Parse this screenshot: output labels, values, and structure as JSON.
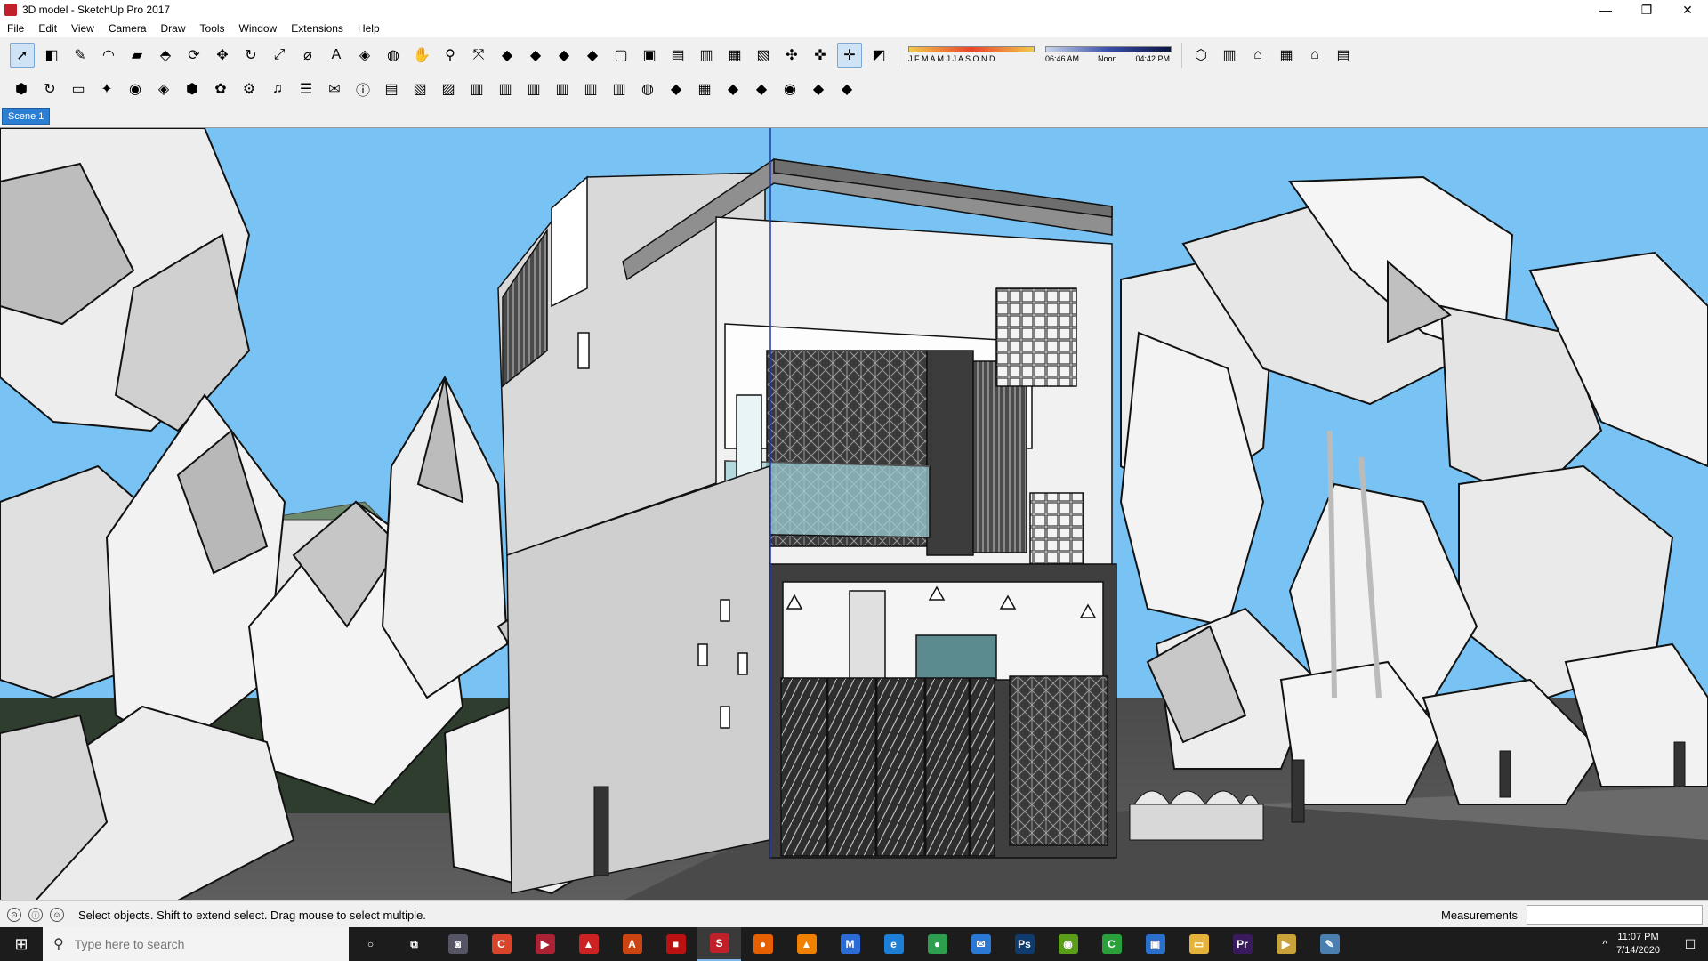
{
  "window": {
    "title": "3D model - SketchUp Pro 2017",
    "controls": [
      "—",
      "❐",
      "✕"
    ]
  },
  "menu": [
    "File",
    "Edit",
    "View",
    "Camera",
    "Draw",
    "Tools",
    "Window",
    "Extensions",
    "Help"
  ],
  "shadow_settings": {
    "months": "J F M A M J J A S O N D",
    "time_start": "06:46 AM",
    "time_noon": "Noon",
    "time_end": "04:42 PM"
  },
  "scenes": [
    "Scene 1"
  ],
  "status": {
    "hint": "Select objects. Shift to extend select. Drag mouse to select multiple.",
    "measurements_label": "Measurements",
    "measurements_value": ""
  },
  "taskbar": {
    "search_placeholder": "Type here to search",
    "time": "11:07 PM",
    "date": "7/14/2020",
    "apps": [
      {
        "name": "cortana-icon",
        "glyph": "○",
        "color": "#1c1c1c"
      },
      {
        "name": "task-view-icon",
        "glyph": "⧉",
        "color": "#1c1c1c"
      },
      {
        "name": "camera-icon",
        "glyph": "◙",
        "color": "#556"
      },
      {
        "name": "screen-recorder-icon",
        "glyph": "C",
        "color": "#d9452b"
      },
      {
        "name": "media-player-icon",
        "glyph": "▶",
        "color": "#a23"
      },
      {
        "name": "pdf-tool-icon",
        "glyph": "▲",
        "color": "#c22"
      },
      {
        "name": "autocad-icon",
        "glyph": "A",
        "color": "#c41"
      },
      {
        "name": "red-app-icon",
        "glyph": "■",
        "color": "#b11"
      },
      {
        "name": "sketchup-icon",
        "glyph": "S",
        "color": "#c0202a"
      },
      {
        "name": "firefox-icon",
        "glyph": "●",
        "color": "#e66000"
      },
      {
        "name": "vlc-icon",
        "glyph": "▲",
        "color": "#f08000"
      },
      {
        "name": "maya-icon",
        "glyph": "M",
        "color": "#2a6bd6"
      },
      {
        "name": "edge-icon",
        "glyph": "e",
        "color": "#1e7fd6"
      },
      {
        "name": "chrome-icon",
        "glyph": "●",
        "color": "#2e9e4f"
      },
      {
        "name": "mail-icon",
        "glyph": "✉",
        "color": "#2a79d4"
      },
      {
        "name": "photoshop-icon",
        "glyph": "Ps",
        "color": "#0f3b6e"
      },
      {
        "name": "nvidia-icon",
        "glyph": "◉",
        "color": "#5a9e1a"
      },
      {
        "name": "camtasia-icon",
        "glyph": "C",
        "color": "#29a03a"
      },
      {
        "name": "store-icon",
        "glyph": "▣",
        "color": "#2a6fc9"
      },
      {
        "name": "file-explorer-icon",
        "glyph": "▭",
        "color": "#e6b33a"
      },
      {
        "name": "premiere-icon",
        "glyph": "Pr",
        "color": "#3a1a5e"
      },
      {
        "name": "media-icon",
        "glyph": "▶",
        "color": "#c9a23a"
      },
      {
        "name": "paint-icon",
        "glyph": "✎",
        "color": "#4a7fb0"
      }
    ],
    "tray_glyph": "^",
    "notification_glyph": "☐"
  },
  "toolbar1": [
    {
      "name": "select-tool-icon",
      "glyph": "➚",
      "active": true
    },
    {
      "name": "eraser-tool-icon",
      "glyph": "◧"
    },
    {
      "name": "line-tool-icon",
      "glyph": "✎"
    },
    {
      "name": "arc-tool-icon",
      "glyph": "◠"
    },
    {
      "name": "rectangle-tool-icon",
      "glyph": "▰"
    },
    {
      "name": "push-pull-tool-icon",
      "glyph": "⬘"
    },
    {
      "name": "offset-tool-icon",
      "glyph": "⟳"
    },
    {
      "name": "move-tool-icon",
      "glyph": "✥"
    },
    {
      "name": "rotate-tool-icon",
      "glyph": "↻"
    },
    {
      "name": "scale-tool-icon",
      "glyph": "⤢"
    },
    {
      "name": "tape-measure-tool-icon",
      "glyph": "⌀"
    },
    {
      "name": "text-tool-icon",
      "glyph": "A"
    },
    {
      "name": "paint-bucket-tool-icon",
      "glyph": "◈"
    },
    {
      "name": "orbit-tool-icon",
      "glyph": "◍"
    },
    {
      "name": "pan-tool-icon",
      "glyph": "✋"
    },
    {
      "name": "zoom-tool-icon",
      "glyph": "⚲"
    },
    {
      "name": "zoom-extents-tool-icon",
      "glyph": "⤧"
    },
    {
      "name": "3d-warehouse-icon",
      "glyph": "◆"
    },
    {
      "name": "extension-warehouse-icon",
      "glyph": "◆"
    },
    {
      "name": "layout-icon",
      "glyph": "◆"
    },
    {
      "name": "ruby-console-icon",
      "glyph": "◆"
    },
    {
      "name": "xray-style-icon",
      "glyph": "▢"
    },
    {
      "name": "back-edges-style-icon",
      "glyph": "▣"
    },
    {
      "name": "wireframe-style-icon",
      "glyph": "▤"
    },
    {
      "name": "hidden-line-style-icon",
      "glyph": "▥"
    },
    {
      "name": "shaded-style-icon",
      "glyph": "▦"
    },
    {
      "name": "textured-style-icon",
      "glyph": "▧"
    },
    {
      "name": "section-plane-icon",
      "glyph": "✣"
    },
    {
      "name": "display-section-planes-icon",
      "glyph": "✜"
    },
    {
      "name": "display-section-cuts-icon",
      "glyph": "✛",
      "active": true
    },
    {
      "name": "shadows-toggle-icon",
      "glyph": "◩"
    }
  ],
  "toolbar1_right": [
    {
      "name": "iso-view-icon",
      "glyph": "⬡"
    },
    {
      "name": "top-view-icon",
      "glyph": "▥"
    },
    {
      "name": "front-view-icon",
      "glyph": "⌂"
    },
    {
      "name": "right-view-icon",
      "glyph": "▦"
    },
    {
      "name": "back-view-icon",
      "glyph": "⌂"
    },
    {
      "name": "left-view-icon",
      "glyph": "▤"
    }
  ],
  "toolbar2": [
    {
      "name": "vray-render-icon",
      "glyph": "⬢"
    },
    {
      "name": "vray-interactive-icon",
      "glyph": "↻"
    },
    {
      "name": "vray-framebuffer-icon",
      "glyph": "▭"
    },
    {
      "name": "vray-light-icon",
      "glyph": "✦"
    },
    {
      "name": "vray-camera-icon",
      "glyph": "◉"
    },
    {
      "name": "vray-proxy-icon",
      "glyph": "◈"
    },
    {
      "name": "vray-asset-editor-icon",
      "glyph": "⬢"
    },
    {
      "name": "vray-fur-icon",
      "glyph": "✿"
    },
    {
      "name": "vray-settings-icon",
      "glyph": "⚙"
    },
    {
      "name": "audio-icon",
      "glyph": "♫"
    },
    {
      "name": "sliders-icon",
      "glyph": "☰"
    },
    {
      "name": "chat-icon",
      "glyph": "✉"
    },
    {
      "name": "info-icon",
      "glyph": "ⓘ"
    },
    {
      "name": "export-layout-icon",
      "glyph": "▤"
    },
    {
      "name": "export-exe-icon",
      "glyph": "▧"
    },
    {
      "name": "export-web-icon",
      "glyph": "▨"
    },
    {
      "name": "panel-layout-1-icon",
      "glyph": "▥"
    },
    {
      "name": "panel-layout-2-icon",
      "glyph": "▥"
    },
    {
      "name": "panel-layout-3-icon",
      "glyph": "▥"
    },
    {
      "name": "panel-layout-4-icon",
      "glyph": "▥"
    },
    {
      "name": "panel-layout-5-icon",
      "glyph": "▥"
    },
    {
      "name": "panel-layout-6-icon",
      "glyph": "▥"
    },
    {
      "name": "globe-icon",
      "glyph": "◍"
    },
    {
      "name": "sandbox-from-contours-icon",
      "glyph": "◆"
    },
    {
      "name": "sandbox-from-scratch-icon",
      "glyph": "▦"
    },
    {
      "name": "sandbox-smoove-icon",
      "glyph": "◆"
    },
    {
      "name": "sandbox-stamp-icon",
      "glyph": "◆"
    },
    {
      "name": "sandbox-drape-icon",
      "glyph": "◉"
    },
    {
      "name": "sandbox-add-detail-icon",
      "glyph": "◆"
    },
    {
      "name": "sandbox-flip-edge-icon",
      "glyph": "◆"
    }
  ]
}
